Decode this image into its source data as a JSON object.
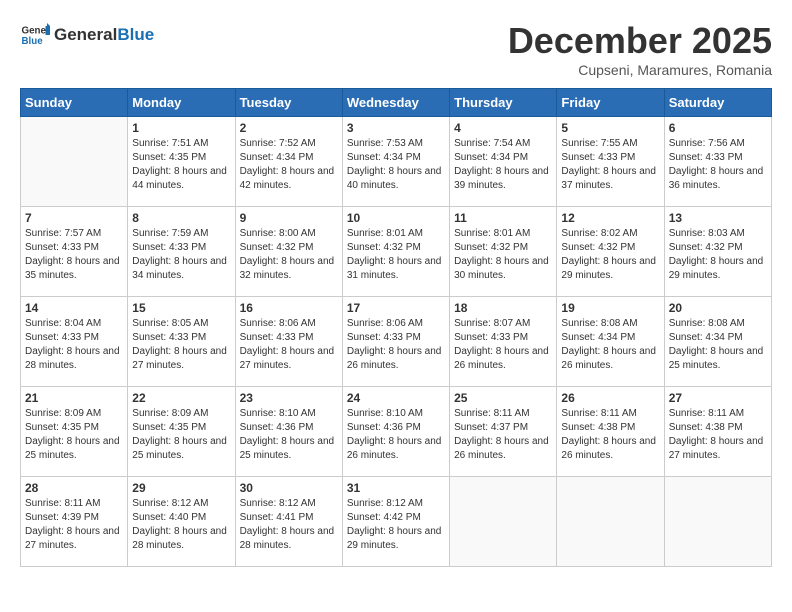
{
  "header": {
    "logo_general": "General",
    "logo_blue": "Blue",
    "month_title": "December 2025",
    "subtitle": "Cupseni, Maramures, Romania"
  },
  "calendar": {
    "weekdays": [
      "Sunday",
      "Monday",
      "Tuesday",
      "Wednesday",
      "Thursday",
      "Friday",
      "Saturday"
    ],
    "weeks": [
      [
        {
          "day": "",
          "sunrise": "",
          "sunset": "",
          "daylight": "",
          "empty": true
        },
        {
          "day": "1",
          "sunrise": "7:51 AM",
          "sunset": "4:35 PM",
          "daylight": "8 hours and 44 minutes."
        },
        {
          "day": "2",
          "sunrise": "7:52 AM",
          "sunset": "4:34 PM",
          "daylight": "8 hours and 42 minutes."
        },
        {
          "day": "3",
          "sunrise": "7:53 AM",
          "sunset": "4:34 PM",
          "daylight": "8 hours and 40 minutes."
        },
        {
          "day": "4",
          "sunrise": "7:54 AM",
          "sunset": "4:34 PM",
          "daylight": "8 hours and 39 minutes."
        },
        {
          "day": "5",
          "sunrise": "7:55 AM",
          "sunset": "4:33 PM",
          "daylight": "8 hours and 37 minutes."
        },
        {
          "day": "6",
          "sunrise": "7:56 AM",
          "sunset": "4:33 PM",
          "daylight": "8 hours and 36 minutes."
        }
      ],
      [
        {
          "day": "7",
          "sunrise": "7:57 AM",
          "sunset": "4:33 PM",
          "daylight": "8 hours and 35 minutes."
        },
        {
          "day": "8",
          "sunrise": "7:59 AM",
          "sunset": "4:33 PM",
          "daylight": "8 hours and 34 minutes."
        },
        {
          "day": "9",
          "sunrise": "8:00 AM",
          "sunset": "4:32 PM",
          "daylight": "8 hours and 32 minutes."
        },
        {
          "day": "10",
          "sunrise": "8:01 AM",
          "sunset": "4:32 PM",
          "daylight": "8 hours and 31 minutes."
        },
        {
          "day": "11",
          "sunrise": "8:01 AM",
          "sunset": "4:32 PM",
          "daylight": "8 hours and 30 minutes."
        },
        {
          "day": "12",
          "sunrise": "8:02 AM",
          "sunset": "4:32 PM",
          "daylight": "8 hours and 29 minutes."
        },
        {
          "day": "13",
          "sunrise": "8:03 AM",
          "sunset": "4:32 PM",
          "daylight": "8 hours and 29 minutes."
        }
      ],
      [
        {
          "day": "14",
          "sunrise": "8:04 AM",
          "sunset": "4:33 PM",
          "daylight": "8 hours and 28 minutes."
        },
        {
          "day": "15",
          "sunrise": "8:05 AM",
          "sunset": "4:33 PM",
          "daylight": "8 hours and 27 minutes."
        },
        {
          "day": "16",
          "sunrise": "8:06 AM",
          "sunset": "4:33 PM",
          "daylight": "8 hours and 27 minutes."
        },
        {
          "day": "17",
          "sunrise": "8:06 AM",
          "sunset": "4:33 PM",
          "daylight": "8 hours and 26 minutes."
        },
        {
          "day": "18",
          "sunrise": "8:07 AM",
          "sunset": "4:33 PM",
          "daylight": "8 hours and 26 minutes."
        },
        {
          "day": "19",
          "sunrise": "8:08 AM",
          "sunset": "4:34 PM",
          "daylight": "8 hours and 26 minutes."
        },
        {
          "day": "20",
          "sunrise": "8:08 AM",
          "sunset": "4:34 PM",
          "daylight": "8 hours and 25 minutes."
        }
      ],
      [
        {
          "day": "21",
          "sunrise": "8:09 AM",
          "sunset": "4:35 PM",
          "daylight": "8 hours and 25 minutes."
        },
        {
          "day": "22",
          "sunrise": "8:09 AM",
          "sunset": "4:35 PM",
          "daylight": "8 hours and 25 minutes."
        },
        {
          "day": "23",
          "sunrise": "8:10 AM",
          "sunset": "4:36 PM",
          "daylight": "8 hours and 25 minutes."
        },
        {
          "day": "24",
          "sunrise": "8:10 AM",
          "sunset": "4:36 PM",
          "daylight": "8 hours and 26 minutes."
        },
        {
          "day": "25",
          "sunrise": "8:11 AM",
          "sunset": "4:37 PM",
          "daylight": "8 hours and 26 minutes."
        },
        {
          "day": "26",
          "sunrise": "8:11 AM",
          "sunset": "4:38 PM",
          "daylight": "8 hours and 26 minutes."
        },
        {
          "day": "27",
          "sunrise": "8:11 AM",
          "sunset": "4:38 PM",
          "daylight": "8 hours and 27 minutes."
        }
      ],
      [
        {
          "day": "28",
          "sunrise": "8:11 AM",
          "sunset": "4:39 PM",
          "daylight": "8 hours and 27 minutes."
        },
        {
          "day": "29",
          "sunrise": "8:12 AM",
          "sunset": "4:40 PM",
          "daylight": "8 hours and 28 minutes."
        },
        {
          "day": "30",
          "sunrise": "8:12 AM",
          "sunset": "4:41 PM",
          "daylight": "8 hours and 28 minutes."
        },
        {
          "day": "31",
          "sunrise": "8:12 AM",
          "sunset": "4:42 PM",
          "daylight": "8 hours and 29 minutes."
        },
        {
          "day": "",
          "sunrise": "",
          "sunset": "",
          "daylight": "",
          "empty": true
        },
        {
          "day": "",
          "sunrise": "",
          "sunset": "",
          "daylight": "",
          "empty": true
        },
        {
          "day": "",
          "sunrise": "",
          "sunset": "",
          "daylight": "",
          "empty": true
        }
      ]
    ],
    "labels": {
      "sunrise": "Sunrise:",
      "sunset": "Sunset:",
      "daylight": "Daylight:"
    }
  }
}
